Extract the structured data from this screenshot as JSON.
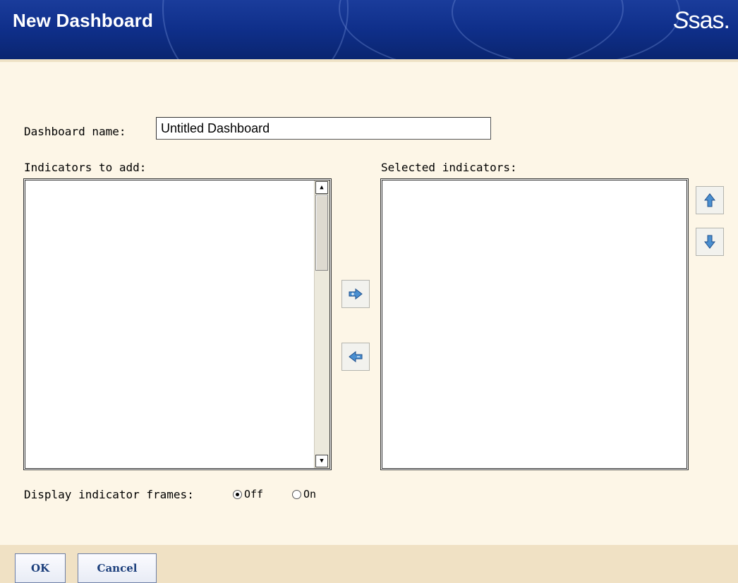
{
  "header": {
    "title": "New Dashboard",
    "logo_text": "sas."
  },
  "form": {
    "name_label": "Dashboard name:",
    "name_value": "Untitled Dashboard",
    "available_label": "Indicators to add:",
    "selected_label": "Selected indicators:",
    "available_items": [],
    "selected_items": [],
    "frames_label": "Display indicator frames:",
    "frames_options": [
      {
        "label": "Off",
        "selected": true
      },
      {
        "label": "On",
        "selected": false
      }
    ]
  },
  "icons": {
    "move_right": "arrow-right-icon",
    "move_left": "arrow-left-icon",
    "move_up": "arrow-up-icon",
    "move_down": "arrow-down-icon"
  },
  "footer": {
    "ok_label": "OK",
    "cancel_label": "Cancel"
  },
  "colors": {
    "header_blue": "#0f2f8a",
    "background": "#fdf6e7",
    "footer": "#f0e1c4",
    "arrow_blue": "#3f84c8"
  }
}
